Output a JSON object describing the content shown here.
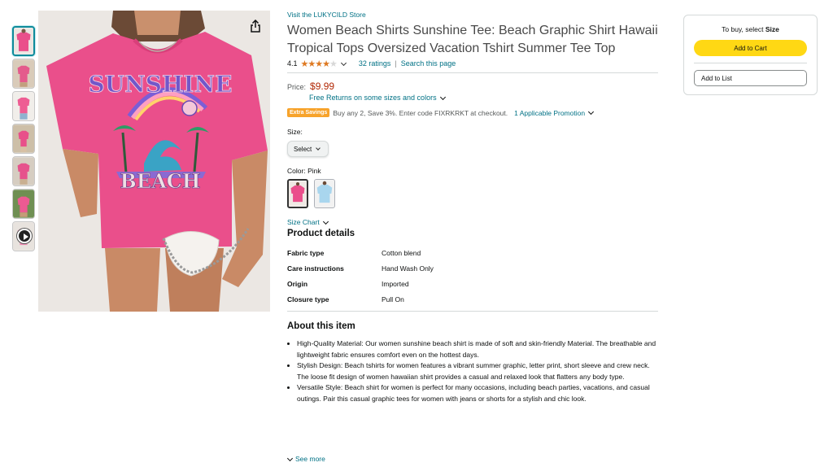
{
  "store_link": "Visit the LUKYCILD Store",
  "title": "Women Beach Shirts Sunshine Tee: Beach Graphic Shirt Hawaii Tropical Tops Oversized Vacation Tshirt Summer Tee Top",
  "rating": {
    "value": "4.1",
    "stars": 4.1,
    "count_text": "32 ratings",
    "search_link": "Search this page"
  },
  "price": {
    "label": "Price:",
    "amount": "$9.99",
    "returns": "Free Returns on some sizes and colors"
  },
  "promo": {
    "badge": "Extra Savings",
    "text": "Buy any 2, Save 3%. Enter code FIXRKRKT at checkout.",
    "link": "1 Applicable Promotion"
  },
  "size": {
    "label": "Size:",
    "select": "Select"
  },
  "color": {
    "label_prefix": "Color:",
    "value": "Pink",
    "options": [
      "Pink",
      "Light Blue"
    ]
  },
  "size_chart": "Size Chart",
  "product_details": {
    "title": "Product details",
    "rows": [
      {
        "key": "Fabric type",
        "value": "Cotton blend"
      },
      {
        "key": "Care instructions",
        "value": "Hand Wash Only"
      },
      {
        "key": "Origin",
        "value": "Imported"
      },
      {
        "key": "Closure type",
        "value": "Pull On"
      }
    ]
  },
  "about": {
    "title": "About this item",
    "bullets": [
      "High-Quality Material: Our women sunshine beach shirt is made of soft and skin-friendly Material. The breathable and lightweight fabric ensures comfort even on the hottest days.",
      "Stylish Design: Beach tshirts for women features a vibrant summer graphic, letter print, short sleeve and crew neck. The loose fit design of women hawaiian shirt provides a casual and relaxed look that flatters any body type.",
      "Versatile Style: Beach shirt for women is perfect for many occasions, including beach parties, vacations, and casual outings. Pair this casual graphic tees for women with jeans or shorts for a stylish and chic look."
    ],
    "see_more": "See more"
  },
  "buybox": {
    "label_prefix": "To buy, select",
    "label_bold": "Size",
    "add_to_cart": "Add to Cart",
    "add_to_list": "Add to List"
  },
  "image": {
    "print_line1": "SUNSHINE",
    "print_line2": "BEACH"
  },
  "colors": {
    "link": "#007185",
    "price": "#b12704",
    "cart_button": "#ffd814",
    "stars": "#de7921",
    "shirt_pink": "#ea4f8b",
    "badge": "#f7a32b"
  },
  "icons": [
    "share-icon",
    "star-icon",
    "chevron-down-icon",
    "play-icon"
  ]
}
